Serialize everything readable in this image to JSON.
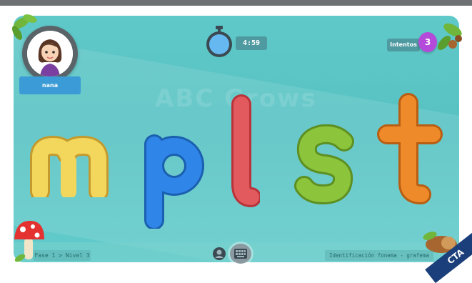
{
  "player": {
    "name": "nana"
  },
  "timer": {
    "value": "4:59",
    "icon": "stopwatch-icon"
  },
  "attempts": {
    "label": "Intentos",
    "count": "3"
  },
  "letters": [
    {
      "char": "m",
      "color": "#f3d75c"
    },
    {
      "char": "p",
      "color": "#2f86e8"
    },
    {
      "char": "l",
      "color": "#e2595e"
    },
    {
      "char": "s",
      "color": "#8cc43c"
    },
    {
      "char": "t",
      "color": "#ef8a2a"
    }
  ],
  "footer": {
    "level": "Fase 1 > Nivel 3",
    "activity": "Identificación fonema - grafema",
    "cta": "CTA"
  },
  "watermark": "ABC Grows",
  "colors": {
    "background": "#5fc8c8",
    "accent_blue": "#3b9bd6",
    "badge_purple": "#b44ad9",
    "label_teal": "#4e9aa0"
  }
}
